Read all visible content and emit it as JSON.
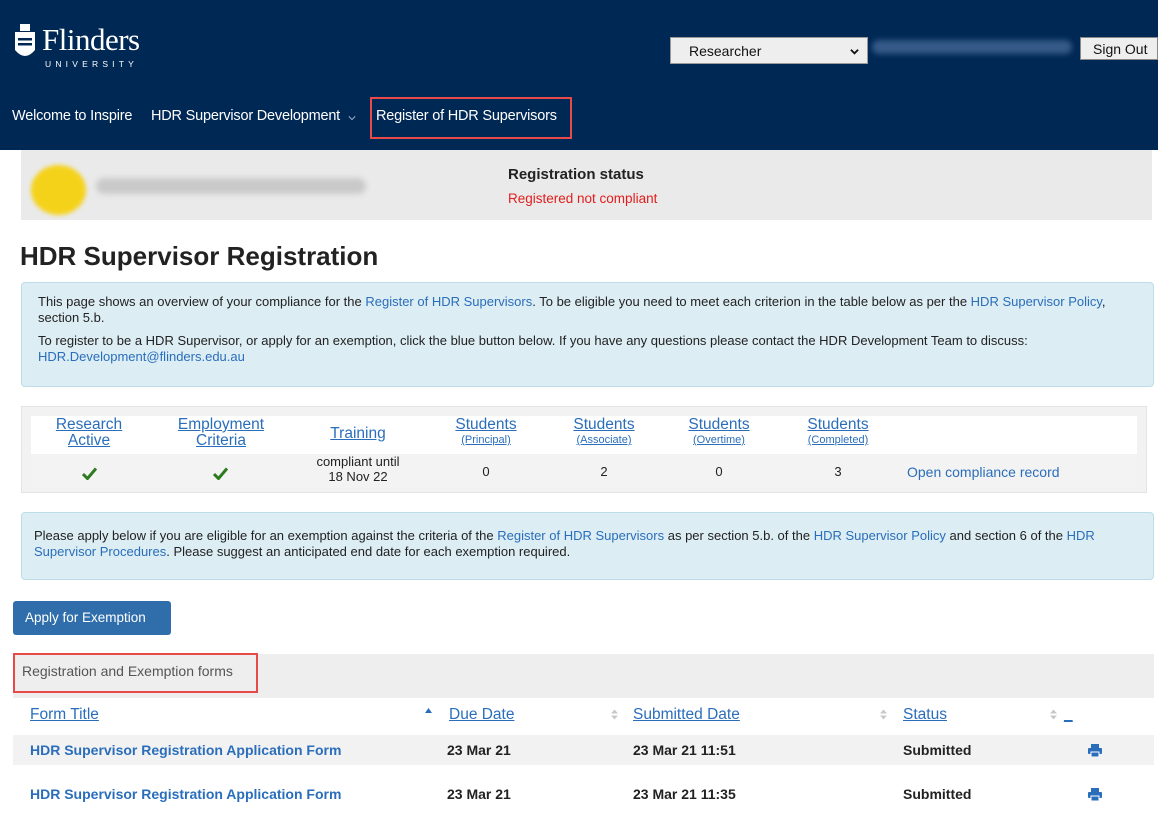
{
  "brand": {
    "name": "Flinders",
    "subtitle": "UNIVERSITY"
  },
  "header": {
    "role_selected": "Researcher",
    "sign_out_label": "Sign Out"
  },
  "nav": {
    "items": [
      {
        "label": "Welcome to Inspire"
      },
      {
        "label": "HDR Supervisor Development"
      },
      {
        "label": "Register of HDR Supervisors"
      }
    ]
  },
  "profile": {
    "registration_title": "Registration status",
    "registration_status": "Registered not compliant",
    "status_color": "#e21d1d"
  },
  "page": {
    "title": "HDR Supervisor Registration"
  },
  "info1": {
    "p1_a": "This page shows an overview of your compliance for the ",
    "p1_link1": "Register of HDR Supervisors",
    "p1_b": ". To be eligible you need to meet each criterion in the table below as per the ",
    "p1_link2": "HDR Supervisor Policy",
    "p1_c": ", section 5.b.",
    "p2_a": "To register to be a HDR Supervisor, or apply for an exemption, click the blue button below. If you have any questions please contact the HDR Development Team to discuss: ",
    "p2_link": "HDR.Development@flinders.edu.au"
  },
  "compliance": {
    "headers": [
      {
        "line1": "Research",
        "line2": "Active"
      },
      {
        "line1": "Employment",
        "line2": "Criteria"
      },
      {
        "line1": "Training"
      },
      {
        "line1": "Students",
        "small": "(Principal)"
      },
      {
        "line1": "Students",
        "small": "(Associate)"
      },
      {
        "line1": "Students",
        "small": "(Overtime)"
      },
      {
        "line1": "Students",
        "small": "(Completed)"
      }
    ],
    "training_value_1": "compliant until",
    "training_value_2": "18 Nov 22",
    "principal": "0",
    "associate": "2",
    "overtime": "0",
    "completed": "3",
    "open_record_label": "Open compliance record",
    "tick_color": "#2d7a1f"
  },
  "info2": {
    "a": "Please apply below if you are eligible for an exemption against the criteria of the ",
    "link1": "Register of HDR Supervisors",
    "b": " as per section 5.b. of the ",
    "link2": "HDR Supervisor Policy",
    "c": " and section 6 of the ",
    "link3": "HDR Supervisor Procedures",
    "d": ". Please suggest an anticipated end date for each exemption required."
  },
  "apply_button_label": "Apply for Exemption",
  "forms": {
    "section_label": "Registration and Exemption forms",
    "columns": {
      "title": "Form Title",
      "due": "Due Date",
      "submitted": "Submitted Date",
      "status": "Status",
      "extra": "_"
    },
    "rows": [
      {
        "title": "HDR Supervisor Registration Application Form",
        "due": "23 Mar 21",
        "submitted": "23 Mar 21 11:51",
        "status": "Submitted"
      },
      {
        "title": "HDR Supervisor Registration Application Form",
        "due": "23 Mar 21",
        "submitted": "23 Mar 21 11:35",
        "status": "Submitted"
      }
    ]
  },
  "colors": {
    "header_bg": "#002855",
    "link": "#2a6ebb",
    "highlight_box": "#e84a4a",
    "button": "#2f6eaa"
  }
}
